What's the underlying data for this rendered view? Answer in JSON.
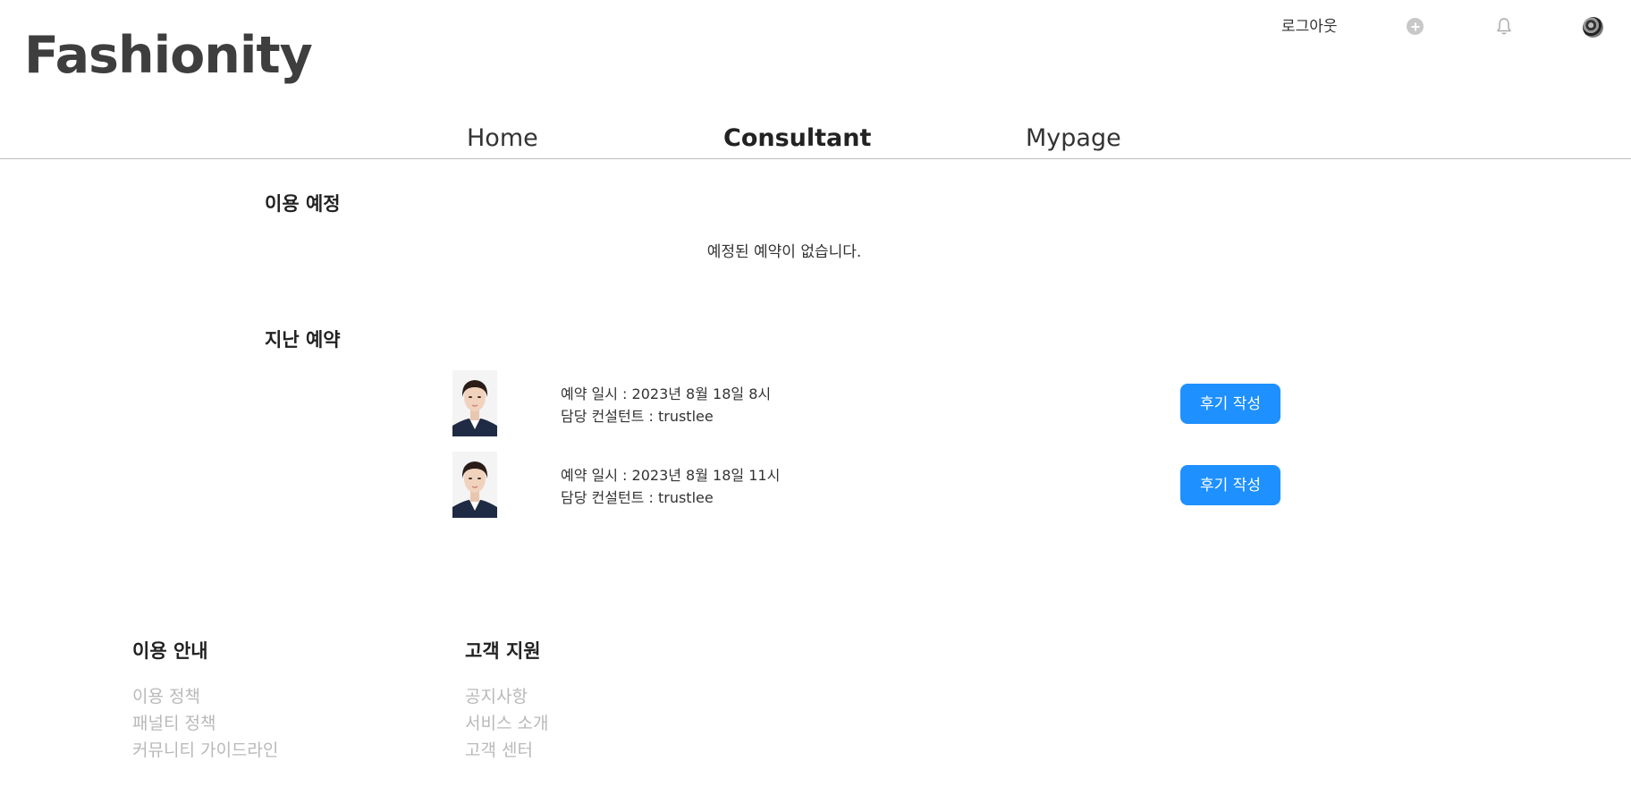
{
  "header": {
    "logo": "Fashionity",
    "logout_label": "로그아웃",
    "icons": [
      "plus-circle-icon",
      "bell-icon",
      "avatar"
    ]
  },
  "nav": {
    "items": [
      {
        "label": "Home",
        "active": false
      },
      {
        "label": "Consultant",
        "active": true
      },
      {
        "label": "Mypage",
        "active": false
      }
    ]
  },
  "upcoming": {
    "title": "이용 예정",
    "empty_message": "예정된 예약이 없습니다."
  },
  "past": {
    "title": "지난 예약",
    "reservations": [
      {
        "datetime": "예약 일시 : 2023년 8월 18일 8시",
        "consultant": "담당 컨설턴트 : trustlee",
        "button_label": "후기 작성"
      },
      {
        "datetime": "예약 일시 : 2023년 8월 18일 11시",
        "consultant": "담당 컨설턴트 : trustlee",
        "button_label": "후기 작성"
      }
    ]
  },
  "footer": {
    "columns": [
      {
        "heading": "이용 안내",
        "links": [
          "이용 정책",
          "패널티 정책",
          "커뮤니티 가이드라인"
        ]
      },
      {
        "heading": "고객 지원",
        "links": [
          "공지사항",
          "서비스 소개",
          "고객 센터"
        ]
      }
    ]
  },
  "colors": {
    "accent": "#1e90ff",
    "logo": "#3e3e3e",
    "footer_link": "#b9b9b9",
    "divider": "#bdbdbd"
  }
}
